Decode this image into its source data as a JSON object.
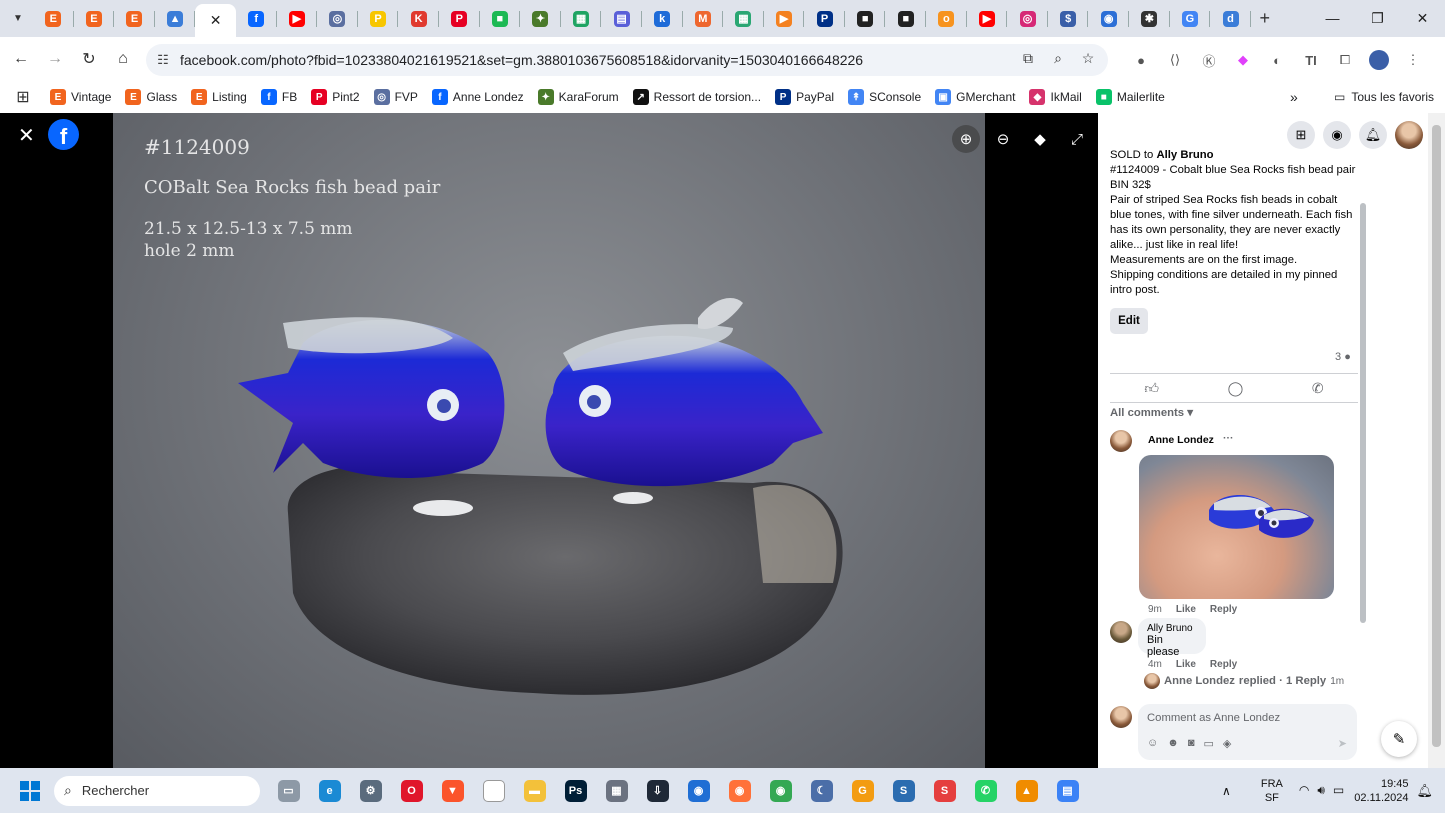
{
  "browser": {
    "tabs": [
      {
        "icon": "etsy-icon",
        "color": "#f1641e",
        "glyph": "E"
      },
      {
        "icon": "etsy-badge-icon",
        "color": "#f1641e",
        "glyph": "E"
      },
      {
        "icon": "etsy-badge-icon",
        "color": "#f1641e",
        "glyph": "E"
      },
      {
        "icon": "triangle-app-icon",
        "color": "#3b7dd8",
        "glyph": "▲"
      },
      {
        "icon": "close-icon",
        "active": true,
        "glyph": "✕"
      },
      {
        "icon": "facebook-icon",
        "color": "#0866ff",
        "glyph": "f"
      },
      {
        "icon": "youtube-icon",
        "color": "#ff0000",
        "glyph": "▶"
      },
      {
        "icon": "fvp-icon",
        "color": "#5b6fa0",
        "glyph": "◎"
      },
      {
        "icon": "p-app-icon",
        "color": "#f7c600",
        "glyph": "P"
      },
      {
        "icon": "k-app-icon",
        "color": "#e03a2f",
        "glyph": "K"
      },
      {
        "icon": "pinterest-icon",
        "color": "#e60023",
        "glyph": "P"
      },
      {
        "icon": "chat-icon",
        "color": "#1db954",
        "glyph": "■"
      },
      {
        "icon": "karaforum-icon",
        "color": "#4a7a2a",
        "glyph": "✦"
      },
      {
        "icon": "sheets-icon",
        "color": "#1fa463",
        "glyph": "▦"
      },
      {
        "icon": "print-icon",
        "color": "#5a5fd8",
        "glyph": "▤"
      },
      {
        "icon": "k-blue-icon",
        "color": "#1e6bd8",
        "glyph": "k"
      },
      {
        "icon": "magento-icon",
        "color": "#ee672f",
        "glyph": "M"
      },
      {
        "icon": "grid-green-icon",
        "color": "#2aa773",
        "glyph": "▦"
      },
      {
        "icon": "play-orange-icon",
        "color": "#f48120",
        "glyph": "▶"
      },
      {
        "icon": "paypal-icon",
        "color": "#003087",
        "glyph": "P"
      },
      {
        "icon": "dark-square-icon",
        "color": "#222222",
        "glyph": "■"
      },
      {
        "icon": "dark-square-icon",
        "color": "#222222",
        "glyph": "■"
      },
      {
        "icon": "ok-icon",
        "color": "#f7931e",
        "glyph": "o"
      },
      {
        "icon": "youtube-icon",
        "color": "#ff0000",
        "glyph": "▶"
      },
      {
        "icon": "instagram-icon",
        "color": "#d62976",
        "glyph": "◎"
      },
      {
        "icon": "dollar-circle-icon",
        "color": "#3a5fa8",
        "glyph": "$"
      },
      {
        "icon": "messenger-icon",
        "color": "#2c6fd6",
        "glyph": "◉"
      },
      {
        "icon": "bluesky-icon",
        "color": "#333333",
        "glyph": "✱"
      },
      {
        "icon": "google-icon",
        "color": "#4285f4",
        "glyph": "G"
      },
      {
        "icon": "d-app-icon",
        "color": "#3b7dd8",
        "glyph": "d"
      }
    ],
    "url": "facebook.com/photo?fbid=10233804021619521&set=gm.3880103675608518&idorvanity=1503040166648226",
    "bookmarks": [
      {
        "label": "Vintage",
        "color": "#f1641e",
        "glyph": "E",
        "icon": "etsy-icon"
      },
      {
        "label": "Glass",
        "color": "#f1641e",
        "glyph": "E",
        "icon": "etsy-icon"
      },
      {
        "label": "Listing",
        "color": "#f1641e",
        "glyph": "E",
        "icon": "etsy-icon"
      },
      {
        "label": "FB",
        "color": "#0866ff",
        "glyph": "f",
        "icon": "facebook-icon"
      },
      {
        "label": "Pint2",
        "color": "#e60023",
        "glyph": "P",
        "icon": "pinterest-icon"
      },
      {
        "label": "FVP",
        "color": "#5b6fa0",
        "glyph": "◎",
        "icon": "fvp-icon"
      },
      {
        "label": "Anne Londez",
        "color": "#0866ff",
        "glyph": "f",
        "icon": "facebook-icon"
      },
      {
        "label": "KaraForum",
        "color": "#4a7a2a",
        "glyph": "✦",
        "icon": "karaforum-icon"
      },
      {
        "label": "Ressort de torsion...",
        "color": "#111111",
        "glyph": "↗",
        "icon": "chart-icon"
      },
      {
        "label": "PayPal",
        "color": "#003087",
        "glyph": "P",
        "icon": "paypal-icon"
      },
      {
        "label": "SConsole",
        "color": "#4285f4",
        "glyph": "↟",
        "icon": "search-console-icon"
      },
      {
        "label": "GMerchant",
        "color": "#4285f4",
        "glyph": "▣",
        "icon": "merchant-icon"
      },
      {
        "label": "IkMail",
        "color": "#d6336c",
        "glyph": "◆",
        "icon": "mail-icon"
      },
      {
        "label": "Mailerlite",
        "color": "#09c269",
        "glyph": "■",
        "icon": "mailerlite-icon"
      }
    ],
    "bookmarks_more": "»",
    "all_bookmarks": "Tous les favoris"
  },
  "photo": {
    "line1": "#1124009",
    "line2": "COBalt Sea Rocks fish bead pair",
    "line3": "21.5 x 12.5-13 x 7.5 mm",
    "line4": "hole 2 mm"
  },
  "post": {
    "sold_prefix": "SOLD to ",
    "sold_name": "Ally Bruno",
    "title": "#1124009 - Cobalt blue Sea Rocks fish bead pair",
    "price": "BIN 32$",
    "body": "Pair of striped Sea Rocks fish beads in cobalt blue tones, with fine silver underneath. Each fish has its own personality, they are never exactly alike... just like in real life!",
    "measure": "Measurements are on the first image.",
    "shipping": "Shipping conditions are detailed in my pinned intro post.",
    "edit_label": "Edit",
    "comment_count": "3",
    "all_comments": "All comments ▾"
  },
  "comments": [
    {
      "author": "Anne Londez",
      "more": "···",
      "time": "9m",
      "like": "Like",
      "reply": "Reply"
    },
    {
      "author": "Ally Bruno",
      "text": "Bin please",
      "time": "4m",
      "like": "Like",
      "reply": "Reply"
    }
  ],
  "replied": {
    "name": "Anne Londez",
    "text": " replied · 1 Reply",
    "time": "1m"
  },
  "composer": {
    "placeholder": "Comment as Anne Londez"
  },
  "taskbar": {
    "search_placeholder": "Rechercher",
    "lang1": "FRA",
    "lang2": "SF",
    "time": "19:45",
    "date": "02.11.2024",
    "apps": [
      {
        "icon": "files-icon",
        "color": "#8d99a6",
        "glyph": "▭"
      },
      {
        "icon": "edge-icon",
        "color": "#1a8ad4",
        "glyph": "e"
      },
      {
        "icon": "settings-icon",
        "color": "#5a6b7d",
        "glyph": "⚙"
      },
      {
        "icon": "opera-icon",
        "color": "#e0162b",
        "glyph": "O"
      },
      {
        "icon": "brave-icon",
        "color": "#fb542b",
        "glyph": "▼"
      },
      {
        "icon": "document-icon",
        "color": "#ffffff",
        "glyph": ""
      },
      {
        "icon": "folder-icon",
        "color": "#f3c13a",
        "glyph": "▬"
      },
      {
        "icon": "photoshop-icon",
        "color": "#001e36",
        "glyph": "Ps"
      },
      {
        "icon": "calculator-icon",
        "color": "#6b7280",
        "glyph": "▦"
      },
      {
        "icon": "store-download-icon",
        "color": "#1f2937",
        "glyph": "⇩"
      },
      {
        "icon": "thunderbird-icon",
        "color": "#1f6ed4",
        "glyph": "◉"
      },
      {
        "icon": "firefox-icon",
        "color": "#ff7139",
        "glyph": "◉"
      },
      {
        "icon": "chrome-icon",
        "color": "#34a853",
        "glyph": "◉"
      },
      {
        "icon": "crescent-icon",
        "color": "#4b6ea8",
        "glyph": "☾"
      },
      {
        "icon": "g-app-icon",
        "color": "#f39c12",
        "glyph": "G"
      },
      {
        "icon": "s-blue-icon",
        "color": "#2b6cb0",
        "glyph": "S"
      },
      {
        "icon": "s-red-icon",
        "color": "#e53e3e",
        "glyph": "S"
      },
      {
        "icon": "whatsapp-icon",
        "color": "#25d366",
        "glyph": "✆"
      },
      {
        "icon": "vlc-icon",
        "color": "#f08c00",
        "glyph": "▲"
      },
      {
        "icon": "notes-icon",
        "color": "#3b82f6",
        "glyph": "▤"
      }
    ]
  },
  "colors": {
    "accent": "#0866ff"
  }
}
